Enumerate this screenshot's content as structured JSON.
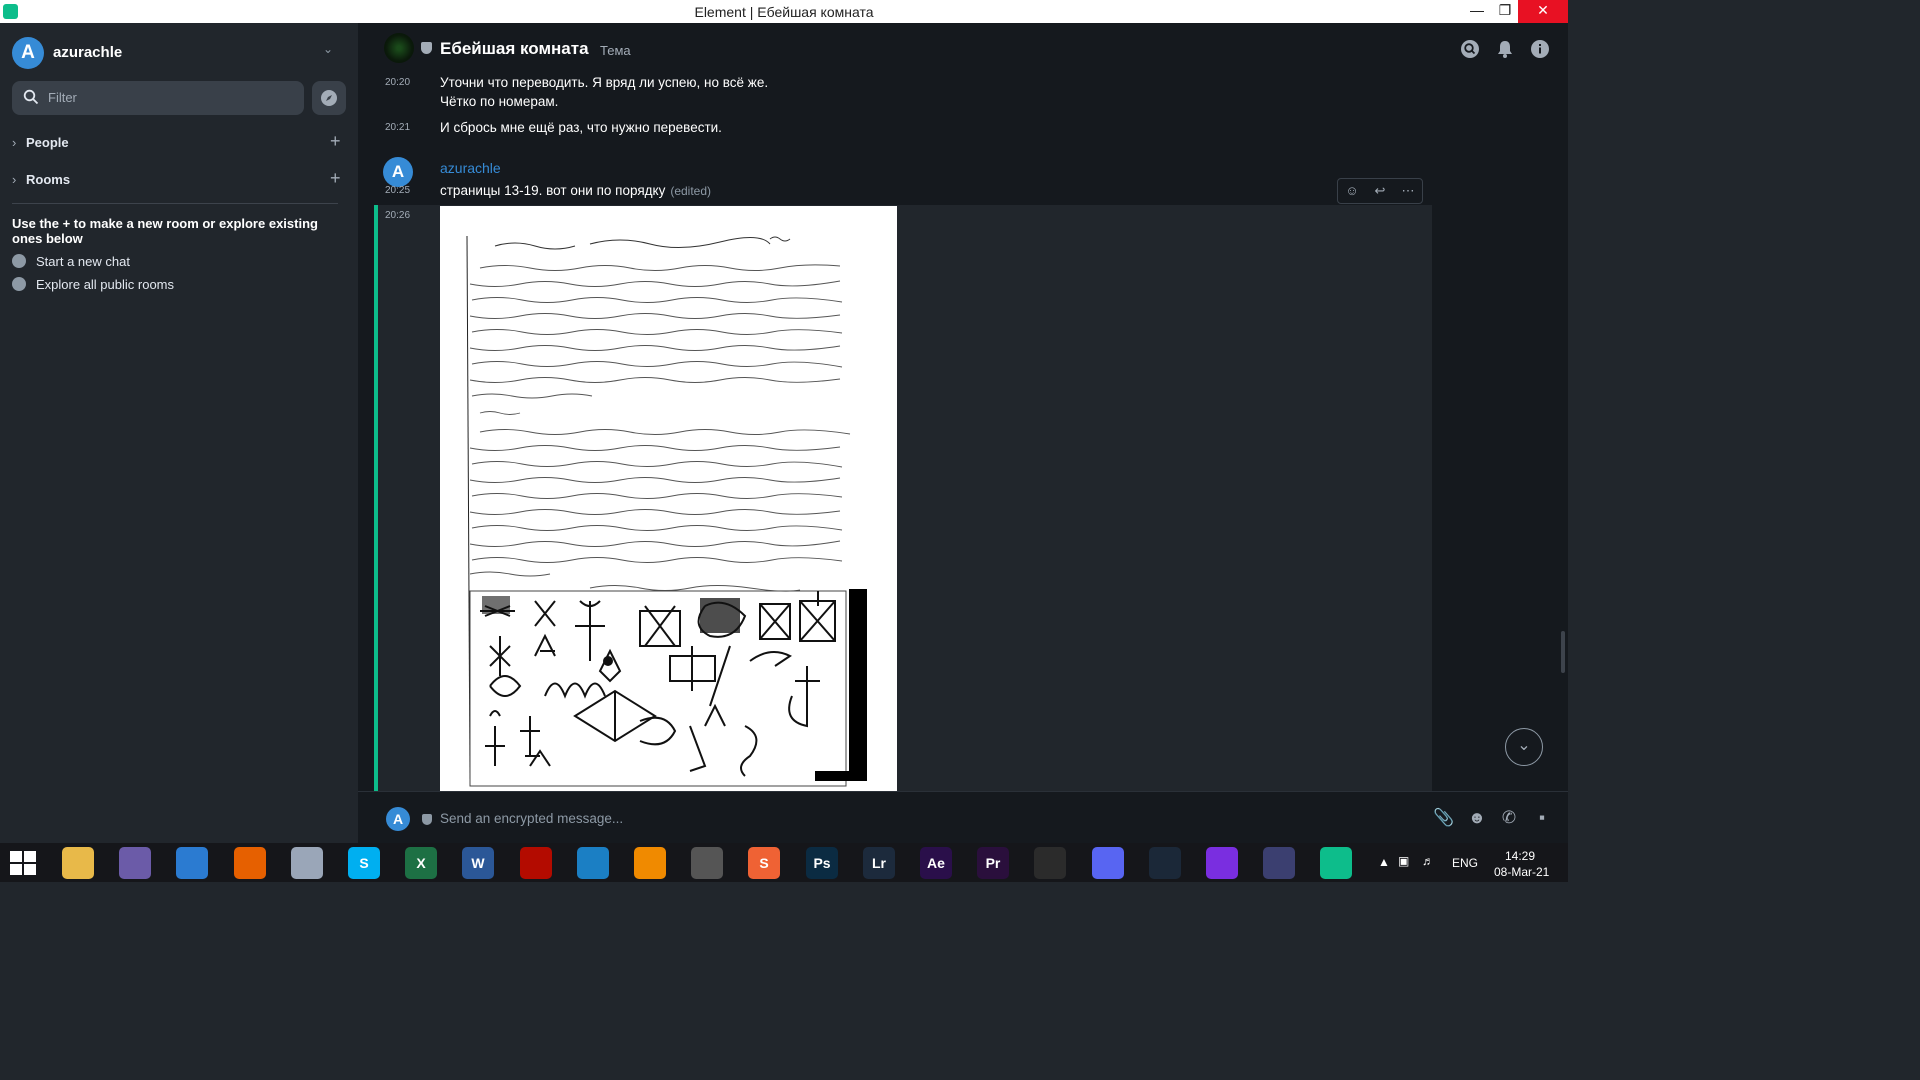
{
  "window": {
    "title": "Element | Ебейшая комната",
    "minimize_label": "—",
    "maximize_label": "❐",
    "close_label": "✕"
  },
  "sidebar": {
    "user": {
      "avatar_letter": "A",
      "name": "azurachle"
    },
    "filter_placeholder": "Filter",
    "sections": [
      {
        "label": "People"
      },
      {
        "label": "Rooms"
      }
    ],
    "explore_hint": "Use the + to make a new room or explore existing ones below",
    "quick_actions": [
      {
        "label": "Start a new chat"
      },
      {
        "label": "Explore all public rooms"
      }
    ]
  },
  "room": {
    "name": "Ебейшая комната",
    "topic": "Тема"
  },
  "timeline": {
    "messages": [
      {
        "time": "20:20",
        "lines": [
          "Уточни что переводить. Я вряд ли успею, но всё же.",
          "Чётко по номерам."
        ]
      },
      {
        "time": "20:21",
        "lines": [
          "И сбрось мне ещё раз, что нужно перевести."
        ]
      }
    ],
    "sender": {
      "avatar_letter": "A",
      "name": "azurachle"
    },
    "sender_message": {
      "time": "20:25",
      "text": "страницы 13-19. вот они по порядку",
      "edited": "(edited)"
    },
    "image_message": {
      "time": "20:26"
    }
  },
  "composer": {
    "avatar_letter": "A",
    "placeholder": "Send an encrypted message..."
  },
  "taskbar": {
    "apps": [
      {
        "icon": "file-explorer-icon",
        "label": "",
        "color": "#e8b949"
      },
      {
        "icon": "bittorrent-icon",
        "label": "",
        "color": "#6b5ba8"
      },
      {
        "icon": "network-icon",
        "label": "",
        "color": "#2b7bd1"
      },
      {
        "icon": "firefox-icon",
        "label": "",
        "color": "#e66000"
      },
      {
        "icon": "globe-icon",
        "label": "",
        "color": "#9aa6b8"
      },
      {
        "icon": "skype-icon",
        "label": "S",
        "color": "#00aff0"
      },
      {
        "icon": "excel-icon",
        "label": "X",
        "color": "#1d7044"
      },
      {
        "icon": "word-icon",
        "label": "W",
        "color": "#2b5797"
      },
      {
        "icon": "acrobat-icon",
        "label": "",
        "color": "#b30b00"
      },
      {
        "icon": "vscode-icon",
        "label": "",
        "color": "#1b7fc4"
      },
      {
        "icon": "vlc-icon",
        "label": "",
        "color": "#f08a00"
      },
      {
        "icon": "downloader-icon",
        "label": "",
        "color": "#555555"
      },
      {
        "icon": "sublime-icon",
        "label": "S",
        "color": "#ef6234"
      },
      {
        "icon": "photoshop-icon",
        "label": "Ps",
        "color": "#0b2b42"
      },
      {
        "icon": "lightroom-icon",
        "label": "Lr",
        "color": "#1c2a3c"
      },
      {
        "icon": "after-effects-icon",
        "label": "Ae",
        "color": "#2a0f4a"
      },
      {
        "icon": "premiere-icon",
        "label": "Pr",
        "color": "#2a0f3c"
      },
      {
        "icon": "obs-icon",
        "label": "",
        "color": "#2b2b2b"
      },
      {
        "icon": "discord-icon",
        "label": "",
        "color": "#5865f2"
      },
      {
        "icon": "steam-icon",
        "label": "",
        "color": "#1b2838"
      },
      {
        "icon": "cortana-icon",
        "label": "",
        "color": "#7a2ee0"
      },
      {
        "icon": "vpn-icon",
        "label": "",
        "color": "#3b3f70"
      },
      {
        "icon": "element-icon",
        "label": "",
        "color": "#0dbd8b"
      }
    ],
    "language": "ENG",
    "time": "14:29",
    "date": "08-Mar-21"
  },
  "colors": {
    "accent": "#0dbd8b",
    "avatar": "#368bd6",
    "sidebar_bg": "#21262c",
    "main_bg": "#15191e"
  }
}
